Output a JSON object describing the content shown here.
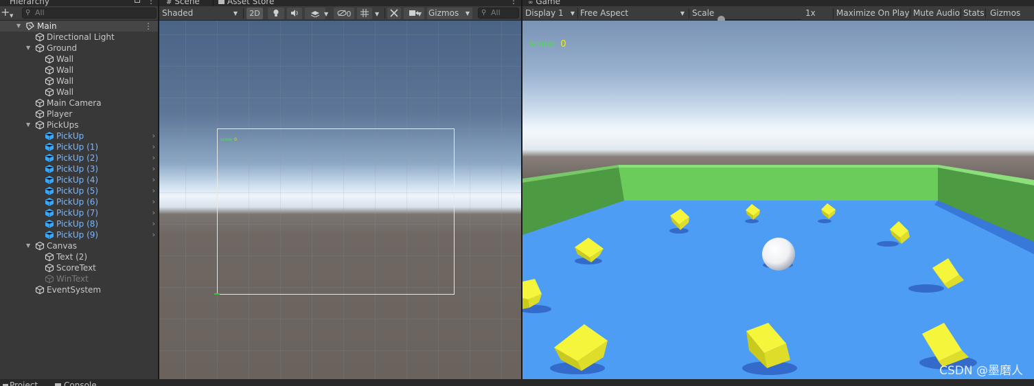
{
  "hierarchy": {
    "tab_label": "Hierarchy",
    "search_placeholder": "All",
    "items": [
      {
        "label": "Main",
        "depth": 0,
        "kind": "scene",
        "fold": "open"
      },
      {
        "label": "Directional Light",
        "depth": 1,
        "kind": "object",
        "fold": "none"
      },
      {
        "label": "Ground",
        "depth": 1,
        "kind": "object",
        "fold": "open"
      },
      {
        "label": "Wall",
        "depth": 2,
        "kind": "object",
        "fold": "none"
      },
      {
        "label": "Wall",
        "depth": 2,
        "kind": "object",
        "fold": "none"
      },
      {
        "label": "Wall",
        "depth": 2,
        "kind": "object",
        "fold": "none"
      },
      {
        "label": "Wall",
        "depth": 2,
        "kind": "object",
        "fold": "none"
      },
      {
        "label": "Main Camera",
        "depth": 1,
        "kind": "object",
        "fold": "none"
      },
      {
        "label": "Player",
        "depth": 1,
        "kind": "object",
        "fold": "none"
      },
      {
        "label": "PickUps",
        "depth": 1,
        "kind": "object",
        "fold": "open"
      },
      {
        "label": "PickUp",
        "depth": 2,
        "kind": "prefab",
        "fold": "none"
      },
      {
        "label": "PickUp (1)",
        "depth": 2,
        "kind": "prefab",
        "fold": "none"
      },
      {
        "label": "PickUp (2)",
        "depth": 2,
        "kind": "prefab",
        "fold": "none"
      },
      {
        "label": "PickUp (3)",
        "depth": 2,
        "kind": "prefab",
        "fold": "none"
      },
      {
        "label": "PickUp (4)",
        "depth": 2,
        "kind": "prefab",
        "fold": "none"
      },
      {
        "label": "PickUp (5)",
        "depth": 2,
        "kind": "prefab",
        "fold": "none"
      },
      {
        "label": "PickUp (6)",
        "depth": 2,
        "kind": "prefab",
        "fold": "none"
      },
      {
        "label": "PickUp (7)",
        "depth": 2,
        "kind": "prefab",
        "fold": "none"
      },
      {
        "label": "PickUp (8)",
        "depth": 2,
        "kind": "prefab",
        "fold": "none"
      },
      {
        "label": "PickUp (9)",
        "depth": 2,
        "kind": "prefab",
        "fold": "none"
      },
      {
        "label": "Canvas",
        "depth": 1,
        "kind": "object",
        "fold": "open"
      },
      {
        "label": "Text (2)",
        "depth": 2,
        "kind": "object",
        "fold": "none"
      },
      {
        "label": "ScoreText",
        "depth": 2,
        "kind": "object",
        "fold": "none"
      },
      {
        "label": "WinText",
        "depth": 2,
        "kind": "disabled",
        "fold": "none"
      },
      {
        "label": "EventSystem",
        "depth": 1,
        "kind": "object",
        "fold": "none"
      }
    ]
  },
  "scene": {
    "tabs": [
      "Scene",
      "Asset Store"
    ],
    "shading_mode": "Shaded",
    "mode_2d_label": "2D",
    "hidden_count": "0",
    "gizmos_label": "Gizmos",
    "search_placeholder": "All",
    "mini_score_label": "score:",
    "mini_score_value": "0"
  },
  "game": {
    "tab_label": "Game",
    "display": "Display 1",
    "aspect": "Free Aspect",
    "scale_label": "Scale",
    "scale_value": "1x",
    "maximize_label": "Maximize On Play",
    "mute_label": "Mute Audio",
    "stats_label": "Stats",
    "gizmos_label": "Gizmos",
    "score_label": "score:",
    "score_value": "0",
    "watermark": "CSDN @墨磨人"
  },
  "bottom_tabs": [
    "Project",
    "Console"
  ],
  "colors": {
    "panel": "#383838",
    "toolbar": "#3c3c3c",
    "selection_text": "#7bb8ff",
    "floor": "#4d9df5",
    "wall": "#6ccc5a",
    "pickup": "#f2f22a",
    "score_label": "#48e048",
    "score_value": "#f0f000"
  }
}
